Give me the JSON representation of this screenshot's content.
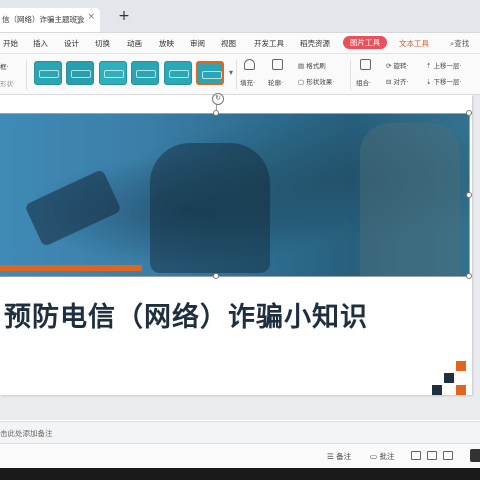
{
  "window": {
    "doc_tab_title": "信（网络）诈骗主题班会",
    "new_tab_symbol": "+"
  },
  "menu": {
    "tabs": [
      "开始",
      "插入",
      "设计",
      "切换",
      "动画",
      "放映",
      "审阅",
      "视图",
      "开发工具",
      "稻壳资源"
    ],
    "active_tab": "图片工具",
    "text_tools": "文本工具",
    "search": "查找"
  },
  "ribbon": {
    "left_labels": [
      "框·",
      "形状·"
    ],
    "style_swatch_colors": [
      "#2aa5b4",
      "#27a0ad",
      "#2fb0bd",
      "#2aa5b4",
      "#29a9b6",
      "#2aa5b4"
    ],
    "swatch_active_border": "#e0661f",
    "fill_label": "填充·",
    "outline_label": "轮廓·",
    "format_painter": "格式刷",
    "shape_effects": "形状效果·",
    "combine": "组合·",
    "rotate": "旋转·",
    "align": "对齐·",
    "bring_forward": "上移一层·",
    "send_backward": "下移一层·"
  },
  "slide": {
    "title": "预防电信（网络）诈骗小知识",
    "orange_accent": "#e0661f",
    "logo_colors": [
      "#e0661f",
      "#1f2f3f",
      "#1f2f3f",
      "#e0661f"
    ]
  },
  "notes": {
    "hint": "击此处添加备注"
  },
  "status": {
    "notes_btn": "备注",
    "comments_btn": "批注"
  }
}
